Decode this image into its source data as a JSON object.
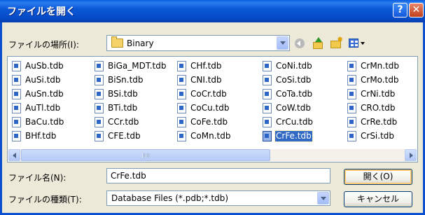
{
  "window": {
    "title": "ファイルを開く"
  },
  "titlebar": {
    "help_glyph": "?",
    "close_glyph": "✕"
  },
  "lookin": {
    "label": "ファイルの場所(I):",
    "value": "Binary"
  },
  "toolbar": {
    "back_icon": "back-icon",
    "up_icon": "up-folder-icon",
    "newfolder_icon": "new-folder-icon",
    "views_icon": "views-menu-icon"
  },
  "files": {
    "columns": [
      [
        "AuSb.tdb",
        "AuSi.tdb",
        "AuSn.tdb",
        "AuTl.tdb",
        "BaCu.tdb",
        "BHf.tdb"
      ],
      [
        "BiGa_MDT.tdb",
        "BiSn.tdb",
        "BSi.tdb",
        "BTi.tdb",
        "CCr.tdb",
        "CFE.tdb"
      ],
      [
        "CHf.tdb",
        "CNI.tdb",
        "CoCr.tdb",
        "CoCu.tdb",
        "CoFe.tdb",
        "CoMn.tdb"
      ],
      [
        "CoNi.tdb",
        "CoSi.tdb",
        "CoTa.tdb",
        "CoW.tdb",
        "CrCu.tdb",
        "CrFe.tdb"
      ],
      [
        "CrMn.tdb",
        "CrMo.tdb",
        "CrNi.tdb",
        "CRO.tdb",
        "CrRe.tdb",
        "CrSi.tdb"
      ]
    ],
    "selected": "CrFe.tdb"
  },
  "filename": {
    "label": "ファイル名(N):",
    "value": "CrFe.tdb"
  },
  "filetype": {
    "label": "ファイルの種類(T):",
    "value": "Database Files (*.pdb;*.tdb)"
  },
  "buttons": {
    "open": "開く(O)",
    "cancel": "キャンセル"
  }
}
